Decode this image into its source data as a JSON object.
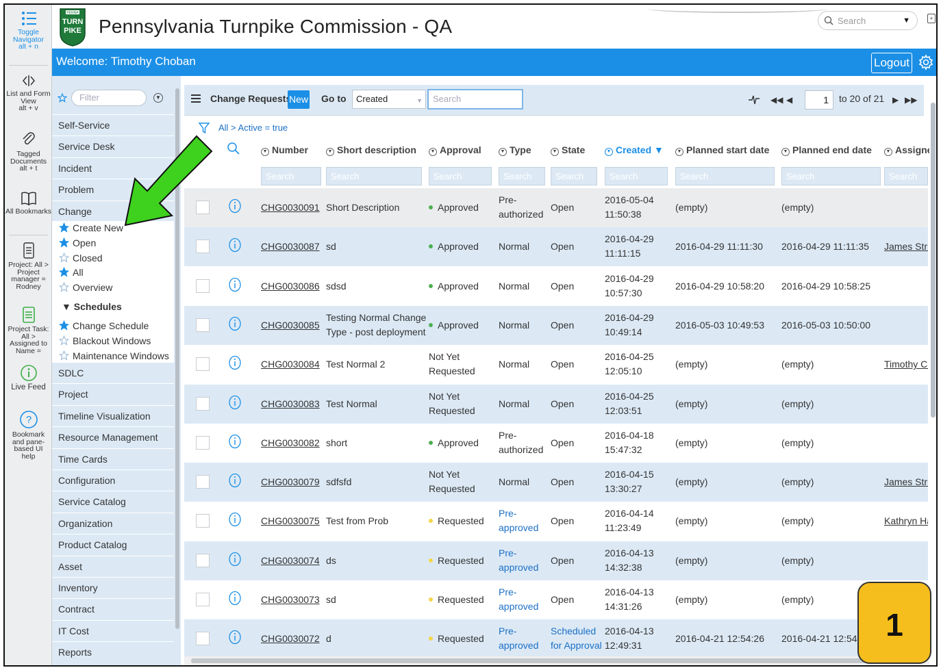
{
  "rail": {
    "items": [
      {
        "label": "Toggle Navigator",
        "shortcut": "alt + n"
      },
      {
        "label": "List and Form View",
        "shortcut": "alt + v"
      },
      {
        "label": "Tagged Documents",
        "shortcut": "alt + t"
      },
      {
        "label": "All Bookmarks"
      },
      {
        "label": "Project: All > Project manager = Rodney"
      },
      {
        "label": "Project Task: All > Assigned to Name ="
      },
      {
        "label": "Live Feed"
      },
      {
        "label": "Bookmark and pane-based UI help"
      }
    ]
  },
  "header": {
    "logo_text_top": "PENNA",
    "logo_text_1": "TURN",
    "logo_text_2": "PIKE",
    "title": "Pennsylvania Turnpike Commission - QA",
    "search_placeholder": "Search"
  },
  "welcome": {
    "text": "Welcome:  Timothy Choban",
    "logout_label": "Logout"
  },
  "navigator": {
    "filter_placeholder": "Filter",
    "modules_top": [
      "Self-Service",
      "Service Desk",
      "Incident",
      "Problem",
      "Change"
    ],
    "change_items": [
      {
        "label": "Create New",
        "starred": true
      },
      {
        "label": "Open",
        "starred": true
      },
      {
        "label": "Closed",
        "starred": false
      },
      {
        "label": "All",
        "starred": true
      },
      {
        "label": "Overview",
        "starred": false
      }
    ],
    "schedules_header": "▼  Schedules",
    "schedule_items": [
      {
        "label": "Change Schedule",
        "starred": true
      },
      {
        "label": "Blackout Windows",
        "starred": false
      },
      {
        "label": "Maintenance Windows",
        "starred": false
      }
    ],
    "modules_bottom": [
      "SDLC",
      "Project",
      "Timeline Visualization",
      "Resource Management",
      "Time Cards",
      "Configuration",
      "Service Catalog",
      "Organization",
      "Product Catalog",
      "Asset",
      "Inventory",
      "Contract",
      "IT Cost",
      "Reports"
    ]
  },
  "list": {
    "title": "Change Requests",
    "new_label": "New",
    "goto_label": "Go to",
    "goto_field": "Created",
    "search_placeholder": "Search",
    "page_current": "1",
    "page_info": "to 20 of 21",
    "breadcrumb": "All > Active = true",
    "columns": [
      "Number",
      "Short description",
      "Approval",
      "Type",
      "State",
      "Created ▼",
      "Planned start date",
      "Planned end date",
      "Assigne"
    ],
    "column_search_placeholder": "Search",
    "rows": [
      {
        "number": "CHG0030091",
        "short": [
          "Short Description"
        ],
        "approval": "Approved",
        "approval_color": "green",
        "type": [
          "Pre-",
          "authorized"
        ],
        "type_blue": false,
        "state": [
          "Open"
        ],
        "state_blue": false,
        "created": [
          "2016-05-04",
          "11:50:38"
        ],
        "start": "(empty)",
        "end": "(empty)",
        "assigned": ""
      },
      {
        "number": "CHG0030087",
        "short": [
          "sd"
        ],
        "approval": "Approved",
        "approval_color": "green",
        "type": [
          "Normal"
        ],
        "type_blue": false,
        "state": [
          "Open"
        ],
        "state_blue": false,
        "created": [
          "2016-04-29",
          "11:11:15"
        ],
        "start": "2016-04-29 11:11:30",
        "end": "2016-04-29 11:11:35",
        "assigned": "James Strie"
      },
      {
        "number": "CHG0030086",
        "short": [
          "sdsd"
        ],
        "approval": "Approved",
        "approval_color": "green",
        "type": [
          "Normal"
        ],
        "type_blue": false,
        "state": [
          "Open"
        ],
        "state_blue": false,
        "created": [
          "2016-04-29",
          "10:57:30"
        ],
        "start": "2016-04-29 10:58:20",
        "end": "2016-04-29 10:58:25",
        "assigned": ""
      },
      {
        "number": "CHG0030085",
        "short": [
          "Testing Normal Change",
          "Type - post deployment"
        ],
        "approval": "Approved",
        "approval_color": "green",
        "type": [
          "Normal"
        ],
        "type_blue": false,
        "state": [
          "Open"
        ],
        "state_blue": false,
        "created": [
          "2016-04-29",
          "10:49:14"
        ],
        "start": "2016-05-03 10:49:53",
        "end": "2016-05-03 10:50:00",
        "assigned": ""
      },
      {
        "number": "CHG0030084",
        "short": [
          "Test Normal 2"
        ],
        "approval": "Not Yet Requested",
        "approval_color": "",
        "type": [
          "Normal"
        ],
        "type_blue": false,
        "state": [
          "Open"
        ],
        "state_blue": false,
        "created": [
          "2016-04-25",
          "12:05:10"
        ],
        "start": "(empty)",
        "end": "(empty)",
        "assigned": "Timothy Ch"
      },
      {
        "number": "CHG0030083",
        "short": [
          "Test Normal"
        ],
        "approval": "Not Yet Requested",
        "approval_color": "",
        "type": [
          "Normal"
        ],
        "type_blue": false,
        "state": [
          "Open"
        ],
        "state_blue": false,
        "created": [
          "2016-04-25",
          "12:03:51"
        ],
        "start": "(empty)",
        "end": "(empty)",
        "assigned": ""
      },
      {
        "number": "CHG0030082",
        "short": [
          "short"
        ],
        "approval": "Approved",
        "approval_color": "green",
        "type": [
          "Pre-",
          "authorized"
        ],
        "type_blue": false,
        "state": [
          "Open"
        ],
        "state_blue": false,
        "created": [
          "2016-04-18",
          "15:47:32"
        ],
        "start": "(empty)",
        "end": "(empty)",
        "assigned": ""
      },
      {
        "number": "CHG0030079",
        "short": [
          "sdfsfd"
        ],
        "approval": "Not Yet Requested",
        "approval_color": "",
        "type": [
          "Normal"
        ],
        "type_blue": false,
        "state": [
          "Open"
        ],
        "state_blue": false,
        "created": [
          "2016-04-15",
          "13:30:27"
        ],
        "start": "(empty)",
        "end": "(empty)",
        "assigned": "James Strie"
      },
      {
        "number": "CHG0030075",
        "short": [
          "Test from Prob"
        ],
        "approval": "Requested",
        "approval_color": "yellow",
        "type": [
          "Pre-",
          "approved"
        ],
        "type_blue": true,
        "state": [
          "Open"
        ],
        "state_blue": false,
        "created": [
          "2016-04-14",
          "11:23:49"
        ],
        "start": "(empty)",
        "end": "(empty)",
        "assigned": "Kathryn Ha"
      },
      {
        "number": "CHG0030074",
        "short": [
          "ds"
        ],
        "approval": "Requested",
        "approval_color": "yellow",
        "type": [
          "Pre-",
          "approved"
        ],
        "type_blue": true,
        "state": [
          "Open"
        ],
        "state_blue": false,
        "created": [
          "2016-04-13",
          "14:32:38"
        ],
        "start": "(empty)",
        "end": "(empty)",
        "assigned": ""
      },
      {
        "number": "CHG0030073",
        "short": [
          "sd"
        ],
        "approval": "Requested",
        "approval_color": "yellow",
        "type": [
          "Pre-",
          "approved"
        ],
        "type_blue": true,
        "state": [
          "Open"
        ],
        "state_blue": false,
        "created": [
          "2016-04-13",
          "14:31:26"
        ],
        "start": "(empty)",
        "end": "(empty)",
        "assigned": ""
      },
      {
        "number": "CHG0030072",
        "short": [
          "d"
        ],
        "approval": "Requested",
        "approval_color": "yellow",
        "type": [
          "Pre-",
          "approved"
        ],
        "type_blue": true,
        "state": [
          "Scheduled",
          "for Approval"
        ],
        "state_blue": true,
        "created": [
          "2016-04-13",
          "12:49:31"
        ],
        "start": "2016-04-21 12:54:26",
        "end": "2016-04-21 12:54:3",
        "assigned": ""
      }
    ]
  },
  "annotation": {
    "step_number": "1"
  },
  "colors": {
    "accent": "#1b8fe6",
    "nav_bg": "#dce9f5",
    "badge": "#f6be1c",
    "arrow": "#3ed21e"
  }
}
